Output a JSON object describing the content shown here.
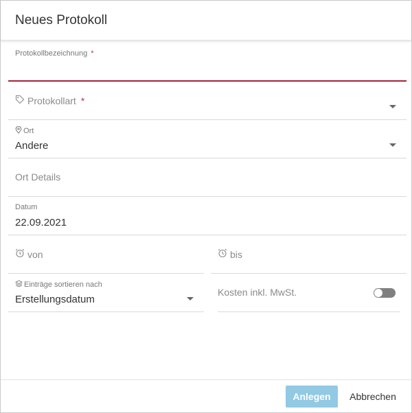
{
  "dialog": {
    "title": "Neues Protokoll"
  },
  "form": {
    "protokollbezeichnung": {
      "label": "Protokollbezeichnung",
      "required_mark": "*",
      "value": ""
    },
    "protokollart": {
      "label": "Protokollart",
      "required_mark": "*",
      "icon": "tag-icon",
      "value": ""
    },
    "ort": {
      "label": "Ort",
      "icon": "location-pin-icon",
      "value": "Andere"
    },
    "ort_details": {
      "label": "Ort Details",
      "value": ""
    },
    "datum": {
      "label": "Datum",
      "value": "22.09.2021"
    },
    "von": {
      "label": "von",
      "icon": "alarm-clock-icon",
      "value": ""
    },
    "bis": {
      "label": "bis",
      "icon": "alarm-clock-icon",
      "value": ""
    },
    "sortierung": {
      "label": "Einträge sortieren nach",
      "icon": "layers-icon",
      "value": "Erstellungsdatum"
    },
    "kosten": {
      "label": "Kosten inkl. MwSt.",
      "enabled": false
    }
  },
  "footer": {
    "create_label": "Anlegen",
    "cancel_label": "Abbrechen"
  },
  "colors": {
    "accent": "#a3203a",
    "primary_button": "#92c9e3",
    "toggle_off": "#808080"
  }
}
